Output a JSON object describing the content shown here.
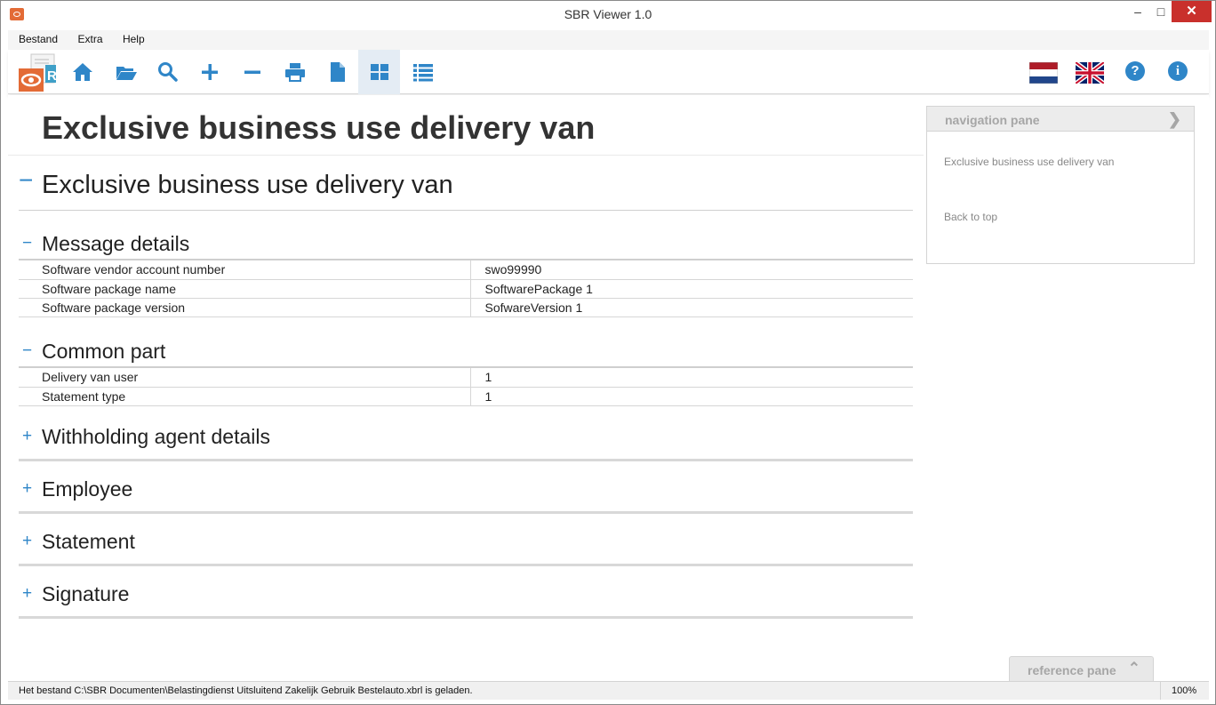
{
  "window": {
    "title": "SBR Viewer 1.0",
    "minimize_glyph": "–",
    "maximize_glyph": "□",
    "close_glyph": "✕"
  },
  "menu": [
    {
      "label": "Bestand"
    },
    {
      "label": "Extra"
    },
    {
      "label": "Help"
    }
  ],
  "toolbar": {
    "icons": [
      "home-icon",
      "open-folder-icon",
      "search-icon",
      "zoom-in-icon",
      "zoom-out-icon",
      "print-icon",
      "document-icon",
      "grid-view-icon",
      "list-view-icon"
    ],
    "active": "grid-view-icon",
    "help_glyph": "?",
    "info_glyph": "i",
    "accent": "#2f86c8"
  },
  "document": {
    "title": "Exclusive business use delivery van",
    "main_section": {
      "toggle": "−",
      "label": "Exclusive business use delivery van"
    },
    "message_details": {
      "toggle": "−",
      "label": "Message details",
      "rows": [
        {
          "label": "Software vendor account number",
          "value": "swo99990"
        },
        {
          "label": "Software package name",
          "value": "SoftwarePackage 1"
        },
        {
          "label": "Software package version",
          "value": "SofwareVersion 1"
        }
      ]
    },
    "common_part": {
      "toggle": "−",
      "label": "Common part",
      "rows": [
        {
          "label": "Delivery van user",
          "value": "1"
        },
        {
          "label": "Statement type",
          "value": "1"
        }
      ]
    },
    "collapsed_sections": [
      {
        "toggle": "+",
        "label": "Withholding agent details"
      },
      {
        "toggle": "+",
        "label": "Employee"
      },
      {
        "toggle": "+",
        "label": "Statement"
      },
      {
        "toggle": "+",
        "label": "Signature"
      }
    ]
  },
  "navigation_pane": {
    "header": "navigation pane",
    "chevron": "❯",
    "links": [
      "Exclusive business use delivery van",
      "Back to top"
    ]
  },
  "reference_pane": {
    "header": "reference pane",
    "chevron": "⌃"
  },
  "status": {
    "message": "Het bestand C:\\SBR Documenten\\Belastingdienst Uitsluitend Zakelijk Gebruik Bestelauto.xbrl is geladen.",
    "zoom": "100%"
  }
}
